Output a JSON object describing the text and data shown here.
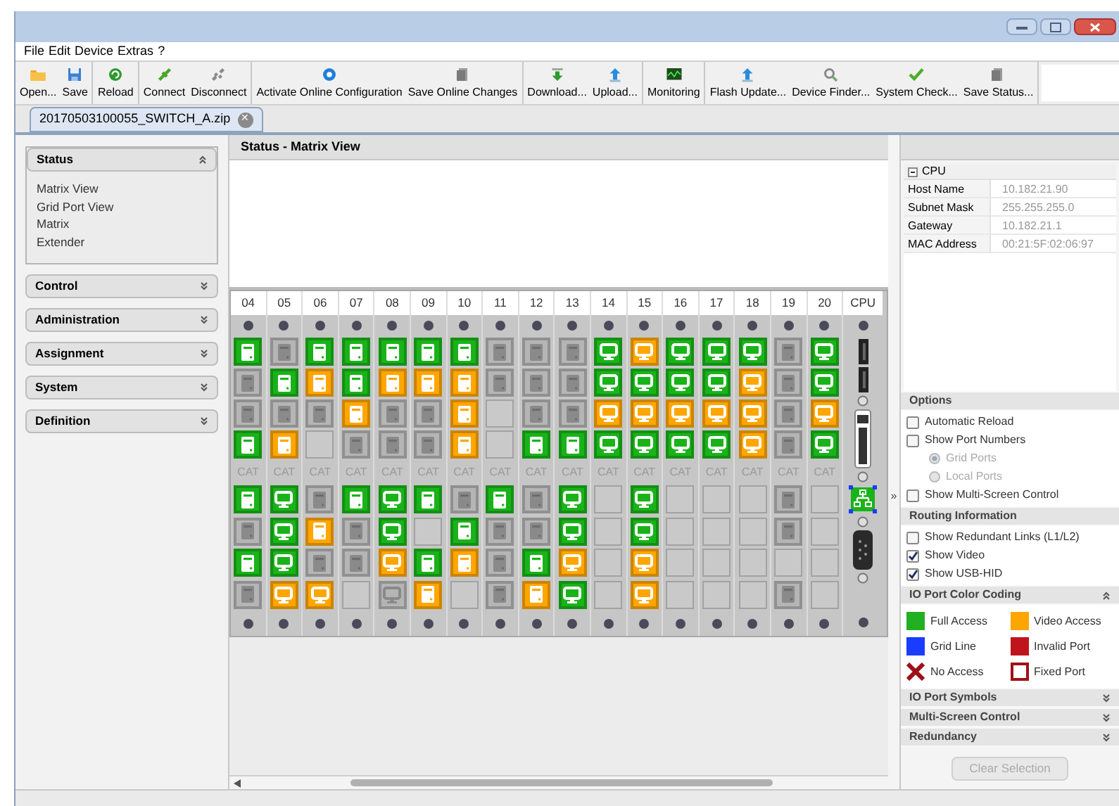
{
  "menu": [
    "File",
    "Edit",
    "Device",
    "Extras",
    "?"
  ],
  "toolbar_groups": [
    [
      {
        "label": "Open..."
      },
      {
        "label": "Save"
      }
    ],
    [
      {
        "label": "Reload"
      }
    ],
    [
      {
        "label": "Connect"
      },
      {
        "label": "Disconnect"
      }
    ],
    [
      {
        "label": "Activate Online Configuration"
      },
      {
        "label": "Save Online Changes"
      }
    ],
    [
      {
        "label": "Download..."
      },
      {
        "label": "Upload..."
      }
    ],
    [
      {
        "label": "Monitoring"
      }
    ],
    [
      {
        "label": "Flash Update..."
      },
      {
        "label": "Device Finder..."
      },
      {
        "label": "System Check..."
      },
      {
        "label": "Save Status..."
      }
    ]
  ],
  "tab": {
    "label": "20170503100055_SWITCH_A.zip",
    "close": "✕"
  },
  "sidebar": [
    {
      "title": "Status",
      "expanded": true,
      "items": [
        "Matrix View",
        "Grid Port View",
        "Matrix",
        "Extender"
      ]
    },
    {
      "title": "Control",
      "expanded": false
    },
    {
      "title": "Administration",
      "expanded": false
    },
    {
      "title": "Assignment",
      "expanded": false
    },
    {
      "title": "System",
      "expanded": false
    },
    {
      "title": "Definition",
      "expanded": false
    }
  ],
  "view_title": "Status - Matrix View",
  "matrix": {
    "columns": [
      {
        "header": "04",
        "cat_label": "CAT",
        "upper_ports": [
          {
            "kind": "computer",
            "color": "#19b319",
            "active": true
          },
          {
            "kind": "computer",
            "color": "#b5b5b5",
            "active": false
          },
          {
            "kind": "computer",
            "color": "#b5b5b5",
            "active": false
          },
          {
            "kind": "computer",
            "color": "#19b319",
            "active": true
          }
        ],
        "lower_ports": [
          {
            "kind": "computer",
            "color": "#19b319",
            "active": true
          },
          {
            "kind": "computer",
            "color": "#b5b5b5",
            "active": false
          },
          {
            "kind": "computer",
            "color": "#19b319",
            "active": true
          },
          {
            "kind": "computer",
            "color": "#b5b5b5",
            "active": false
          }
        ]
      },
      {
        "header": "05",
        "cat_label": "CAT",
        "upper_ports": [
          {
            "kind": "computer",
            "color": "#b5b5b5",
            "active": false
          },
          {
            "kind": "computer",
            "color": "#19b319",
            "active": true
          },
          {
            "kind": "computer",
            "color": "#b5b5b5",
            "active": false
          },
          {
            "kind": "computer",
            "color": "#ffa600",
            "active": true
          }
        ],
        "lower_ports": [
          {
            "kind": "monitor",
            "color": "#19b319",
            "active": true
          },
          {
            "kind": "monitor",
            "color": "#19b319",
            "active": true
          },
          {
            "kind": "monitor",
            "color": "#19b319",
            "active": true
          },
          {
            "kind": "monitor",
            "color": "#ffa600",
            "active": true
          }
        ]
      },
      {
        "header": "06",
        "cat_label": "CAT",
        "upper_ports": [
          {
            "kind": "computer",
            "color": "#19b319",
            "active": true
          },
          {
            "kind": "computer",
            "color": "#ffa600",
            "active": true
          },
          {
            "kind": "computer",
            "color": "#b5b5b5",
            "active": false
          },
          {
            "kind": "empty"
          }
        ],
        "lower_ports": [
          {
            "kind": "computer",
            "color": "#b5b5b5",
            "active": false
          },
          {
            "kind": "computer",
            "color": "#ffa600",
            "active": true
          },
          {
            "kind": "computer",
            "color": "#b5b5b5",
            "active": false
          },
          {
            "kind": "monitor",
            "color": "#ffa600",
            "active": true
          }
        ]
      },
      {
        "header": "07",
        "cat_label": "CAT",
        "upper_ports": [
          {
            "kind": "computer",
            "color": "#19b319",
            "active": true
          },
          {
            "kind": "computer",
            "color": "#19b319",
            "active": true
          },
          {
            "kind": "computer",
            "color": "#ffa600",
            "active": true
          },
          {
            "kind": "computer",
            "color": "#b5b5b5",
            "active": false
          }
        ],
        "lower_ports": [
          {
            "kind": "computer",
            "color": "#19b319",
            "active": true
          },
          {
            "kind": "computer",
            "color": "#b5b5b5",
            "active": false
          },
          {
            "kind": "computer",
            "color": "#b5b5b5",
            "active": false
          },
          {
            "kind": "empty"
          }
        ]
      },
      {
        "header": "08",
        "cat_label": "CAT",
        "upper_ports": [
          {
            "kind": "computer",
            "color": "#19b319",
            "active": true
          },
          {
            "kind": "computer",
            "color": "#ffa600",
            "active": true
          },
          {
            "kind": "computer",
            "color": "#b5b5b5",
            "active": false
          },
          {
            "kind": "computer",
            "color": "#b5b5b5",
            "active": false
          }
        ],
        "lower_ports": [
          {
            "kind": "monitor",
            "color": "#19b319",
            "active": true
          },
          {
            "kind": "monitor",
            "color": "#19b319",
            "active": true
          },
          {
            "kind": "monitor",
            "color": "#ffa600",
            "active": true
          },
          {
            "kind": "monitor",
            "color": "#b5b5b5",
            "active": false
          }
        ]
      },
      {
        "header": "09",
        "cat_label": "CAT",
        "upper_ports": [
          {
            "kind": "computer",
            "color": "#19b319",
            "active": true
          },
          {
            "kind": "computer",
            "color": "#ffa600",
            "active": true
          },
          {
            "kind": "computer",
            "color": "#b5b5b5",
            "active": false
          },
          {
            "kind": "computer",
            "color": "#b5b5b5",
            "active": false
          }
        ],
        "lower_ports": [
          {
            "kind": "computer",
            "color": "#19b319",
            "active": true
          },
          {
            "kind": "empty"
          },
          {
            "kind": "computer",
            "color": "#19b319",
            "active": true
          },
          {
            "kind": "computer",
            "color": "#ffa600",
            "active": true
          }
        ]
      },
      {
        "header": "10",
        "cat_label": "CAT",
        "upper_ports": [
          {
            "kind": "computer",
            "color": "#19b319",
            "active": true
          },
          {
            "kind": "computer",
            "color": "#ffa600",
            "active": true
          },
          {
            "kind": "computer",
            "color": "#ffa600",
            "active": true
          },
          {
            "kind": "computer",
            "color": "#ffa600",
            "active": true
          }
        ],
        "lower_ports": [
          {
            "kind": "computer",
            "color": "#b5b5b5",
            "active": false
          },
          {
            "kind": "computer",
            "color": "#19b319",
            "active": true
          },
          {
            "kind": "computer",
            "color": "#ffa600",
            "active": true
          },
          {
            "kind": "empty"
          }
        ]
      },
      {
        "header": "11",
        "cat_label": "CAT",
        "upper_ports": [
          {
            "kind": "computer",
            "color": "#b5b5b5",
            "active": false
          },
          {
            "kind": "computer",
            "color": "#b5b5b5",
            "active": false
          },
          {
            "kind": "empty"
          },
          {
            "kind": "empty"
          }
        ],
        "lower_ports": [
          {
            "kind": "computer",
            "color": "#19b319",
            "active": true
          },
          {
            "kind": "computer",
            "color": "#b5b5b5",
            "active": false
          },
          {
            "kind": "computer",
            "color": "#b5b5b5",
            "active": false
          },
          {
            "kind": "computer",
            "color": "#b5b5b5",
            "active": false
          }
        ]
      },
      {
        "header": "12",
        "cat_label": "CAT",
        "upper_ports": [
          {
            "kind": "computer",
            "color": "#b5b5b5",
            "active": false
          },
          {
            "kind": "computer",
            "color": "#b5b5b5",
            "active": false
          },
          {
            "kind": "computer",
            "color": "#b5b5b5",
            "active": false
          },
          {
            "kind": "computer",
            "color": "#19b319",
            "active": true
          }
        ],
        "lower_ports": [
          {
            "kind": "computer",
            "color": "#b5b5b5",
            "active": false
          },
          {
            "kind": "computer",
            "color": "#b5b5b5",
            "active": false
          },
          {
            "kind": "computer",
            "color": "#19b319",
            "active": true
          },
          {
            "kind": "computer",
            "color": "#ffa600",
            "active": true
          }
        ]
      },
      {
        "header": "13",
        "cat_label": "CAT",
        "upper_ports": [
          {
            "kind": "computer",
            "color": "#b5b5b5",
            "active": false
          },
          {
            "kind": "computer",
            "color": "#b5b5b5",
            "active": false
          },
          {
            "kind": "computer",
            "color": "#b5b5b5",
            "active": false
          },
          {
            "kind": "computer",
            "color": "#19b319",
            "active": true
          }
        ],
        "lower_ports": [
          {
            "kind": "monitor",
            "color": "#19b319",
            "active": true
          },
          {
            "kind": "monitor",
            "color": "#19b319",
            "active": true
          },
          {
            "kind": "monitor",
            "color": "#ffa600",
            "active": true
          },
          {
            "kind": "monitor",
            "color": "#19b319",
            "active": true
          }
        ]
      },
      {
        "header": "14",
        "cat_label": "CAT",
        "upper_ports": [
          {
            "kind": "monitor",
            "color": "#19b319",
            "active": true
          },
          {
            "kind": "monitor",
            "color": "#19b319",
            "active": true
          },
          {
            "kind": "monitor",
            "color": "#ffa600",
            "active": true
          },
          {
            "kind": "monitor",
            "color": "#19b319",
            "active": true
          }
        ],
        "lower_ports": [
          {
            "kind": "empty"
          },
          {
            "kind": "empty"
          },
          {
            "kind": "empty"
          },
          {
            "kind": "empty"
          }
        ]
      },
      {
        "header": "15",
        "cat_label": "CAT",
        "upper_ports": [
          {
            "kind": "monitor",
            "color": "#ffa600",
            "active": true
          },
          {
            "kind": "monitor",
            "color": "#19b319",
            "active": true
          },
          {
            "kind": "monitor",
            "color": "#ffa600",
            "active": true
          },
          {
            "kind": "monitor",
            "color": "#19b319",
            "active": true
          }
        ],
        "lower_ports": [
          {
            "kind": "monitor",
            "color": "#19b319",
            "active": true
          },
          {
            "kind": "monitor",
            "color": "#19b319",
            "active": true
          },
          {
            "kind": "monitor",
            "color": "#ffa600",
            "active": true
          },
          {
            "kind": "monitor",
            "color": "#ffa600",
            "active": true
          }
        ]
      },
      {
        "header": "16",
        "cat_label": "CAT",
        "upper_ports": [
          {
            "kind": "monitor",
            "color": "#19b319",
            "active": true
          },
          {
            "kind": "monitor",
            "color": "#19b319",
            "active": true
          },
          {
            "kind": "monitor",
            "color": "#ffa600",
            "active": true
          },
          {
            "kind": "monitor",
            "color": "#19b319",
            "active": true
          }
        ],
        "lower_ports": [
          {
            "kind": "empty"
          },
          {
            "kind": "empty"
          },
          {
            "kind": "empty"
          },
          {
            "kind": "empty"
          }
        ]
      },
      {
        "header": "17",
        "cat_label": "CAT",
        "upper_ports": [
          {
            "kind": "monitor",
            "color": "#19b319",
            "active": true
          },
          {
            "kind": "monitor",
            "color": "#19b319",
            "active": true
          },
          {
            "kind": "monitor",
            "color": "#ffa600",
            "active": true
          },
          {
            "kind": "monitor",
            "color": "#19b319",
            "active": true
          }
        ],
        "lower_ports": [
          {
            "kind": "empty"
          },
          {
            "kind": "empty"
          },
          {
            "kind": "empty"
          },
          {
            "kind": "empty"
          }
        ]
      },
      {
        "header": "18",
        "cat_label": "CAT",
        "upper_ports": [
          {
            "kind": "monitor",
            "color": "#19b319",
            "active": true
          },
          {
            "kind": "monitor",
            "color": "#ffa600",
            "active": true
          },
          {
            "kind": "monitor",
            "color": "#ffa600",
            "active": true
          },
          {
            "kind": "monitor",
            "color": "#ffa600",
            "active": true
          }
        ],
        "lower_ports": [
          {
            "kind": "empty"
          },
          {
            "kind": "empty"
          },
          {
            "kind": "empty"
          },
          {
            "kind": "empty"
          }
        ]
      },
      {
        "header": "19",
        "cat_label": "CAT",
        "upper_ports": [
          {
            "kind": "computer",
            "color": "#b5b5b5",
            "active": false
          },
          {
            "kind": "computer",
            "color": "#b5b5b5",
            "active": false
          },
          {
            "kind": "computer",
            "color": "#b5b5b5",
            "active": false
          },
          {
            "kind": "computer",
            "color": "#b5b5b5",
            "active": false
          }
        ],
        "lower_ports": [
          {
            "kind": "computer",
            "color": "#b5b5b5",
            "active": false
          },
          {
            "kind": "computer",
            "color": "#b5b5b5",
            "active": false
          },
          {
            "kind": "empty"
          },
          {
            "kind": "computer",
            "color": "#b5b5b5",
            "active": false
          }
        ]
      },
      {
        "header": "20",
        "cat_label": "CAT",
        "upper_ports": [
          {
            "kind": "monitor",
            "color": "#19b319",
            "active": true
          },
          {
            "kind": "monitor",
            "color": "#19b319",
            "active": true
          },
          {
            "kind": "monitor",
            "color": "#ffa600",
            "active": true
          },
          {
            "kind": "monitor",
            "color": "#19b319",
            "active": true
          }
        ],
        "lower_ports": [
          {
            "kind": "empty"
          },
          {
            "kind": "empty"
          },
          {
            "kind": "empty"
          },
          {
            "kind": "empty"
          }
        ]
      }
    ],
    "cpu": {
      "header": "CPU",
      "network_port": {
        "selected": true
      }
    }
  },
  "splitter_arrow": "»",
  "cpu_info": {
    "title": "CPU",
    "rows": [
      {
        "label": "Host Name",
        "value": "10.182.21.90"
      },
      {
        "label": "Subnet Mask",
        "value": "255.255.255.0"
      },
      {
        "label": "Gateway",
        "value": "10.182.21.1"
      },
      {
        "label": "MAC Address",
        "value": "00:21:5F:02:06:97"
      }
    ]
  },
  "options": {
    "title": "Options",
    "items": [
      {
        "kind": "checkbox",
        "label": "Automatic Reload",
        "checked": false,
        "disabled": false
      },
      {
        "kind": "checkbox",
        "label": "Show Port Numbers",
        "checked": false,
        "disabled": false
      },
      {
        "kind": "radio",
        "label": "Grid Ports",
        "selected": true,
        "disabled": true
      },
      {
        "kind": "radio",
        "label": "Local Ports",
        "selected": false,
        "disabled": true
      },
      {
        "kind": "checkbox",
        "label": "Show Multi-Screen Control",
        "checked": false,
        "disabled": false
      }
    ]
  },
  "routing": {
    "title": "Routing Information",
    "items": [
      {
        "label": "Show Redundant Links (L1/L2)",
        "checked": false
      },
      {
        "label": "Show Video",
        "checked": true
      },
      {
        "label": "Show USB-HID",
        "checked": true
      }
    ]
  },
  "color_coding": {
    "title": "IO Port Color Coding",
    "expanded": true,
    "items": [
      {
        "kind": "swatch",
        "label": "Full Access",
        "color": "#22b022"
      },
      {
        "kind": "swatch",
        "label": "Video Access",
        "color": "#ffa500"
      },
      {
        "kind": "swatch",
        "label": "Grid Line",
        "color": "#1a3cff"
      },
      {
        "kind": "swatch",
        "label": "Invalid Port",
        "color": "#c0141c"
      },
      {
        "kind": "cross",
        "label": "No Access",
        "color": "#a01018"
      },
      {
        "kind": "outline",
        "label": "Fixed Port",
        "color": "#a01018"
      }
    ]
  },
  "collapsed_sections": [
    {
      "title": "IO Port Symbols",
      "expanded": false
    },
    {
      "title": "Multi-Screen Control",
      "expanded": false
    },
    {
      "title": "Redundancy",
      "expanded": false
    }
  ],
  "clear_button": {
    "label": "Clear Selection",
    "disabled": true
  }
}
